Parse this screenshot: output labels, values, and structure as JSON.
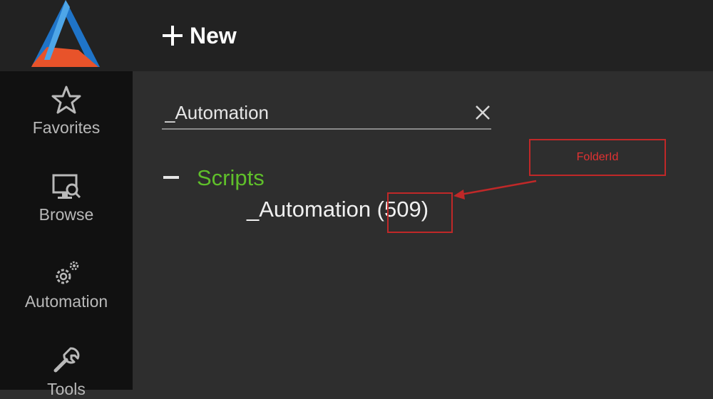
{
  "header": {
    "new_label": "New"
  },
  "sidebar": {
    "items": [
      {
        "label": "Favorites",
        "icon": "star-icon"
      },
      {
        "label": "Browse",
        "icon": "monitor-search-icon"
      },
      {
        "label": "Automation",
        "icon": "gear-icon"
      },
      {
        "label": "Tools",
        "icon": "wrench-icon"
      }
    ]
  },
  "search": {
    "value": "_Automation"
  },
  "tree": {
    "root_label": "Scripts",
    "child_label": "_Automation (509)"
  },
  "annotation": {
    "label": "FolderId"
  },
  "colors": {
    "accent_green": "#5fbf2a",
    "annotation_red": "#c02828",
    "logo_blue": "#1f74c8",
    "logo_orange": "#e8532a"
  }
}
